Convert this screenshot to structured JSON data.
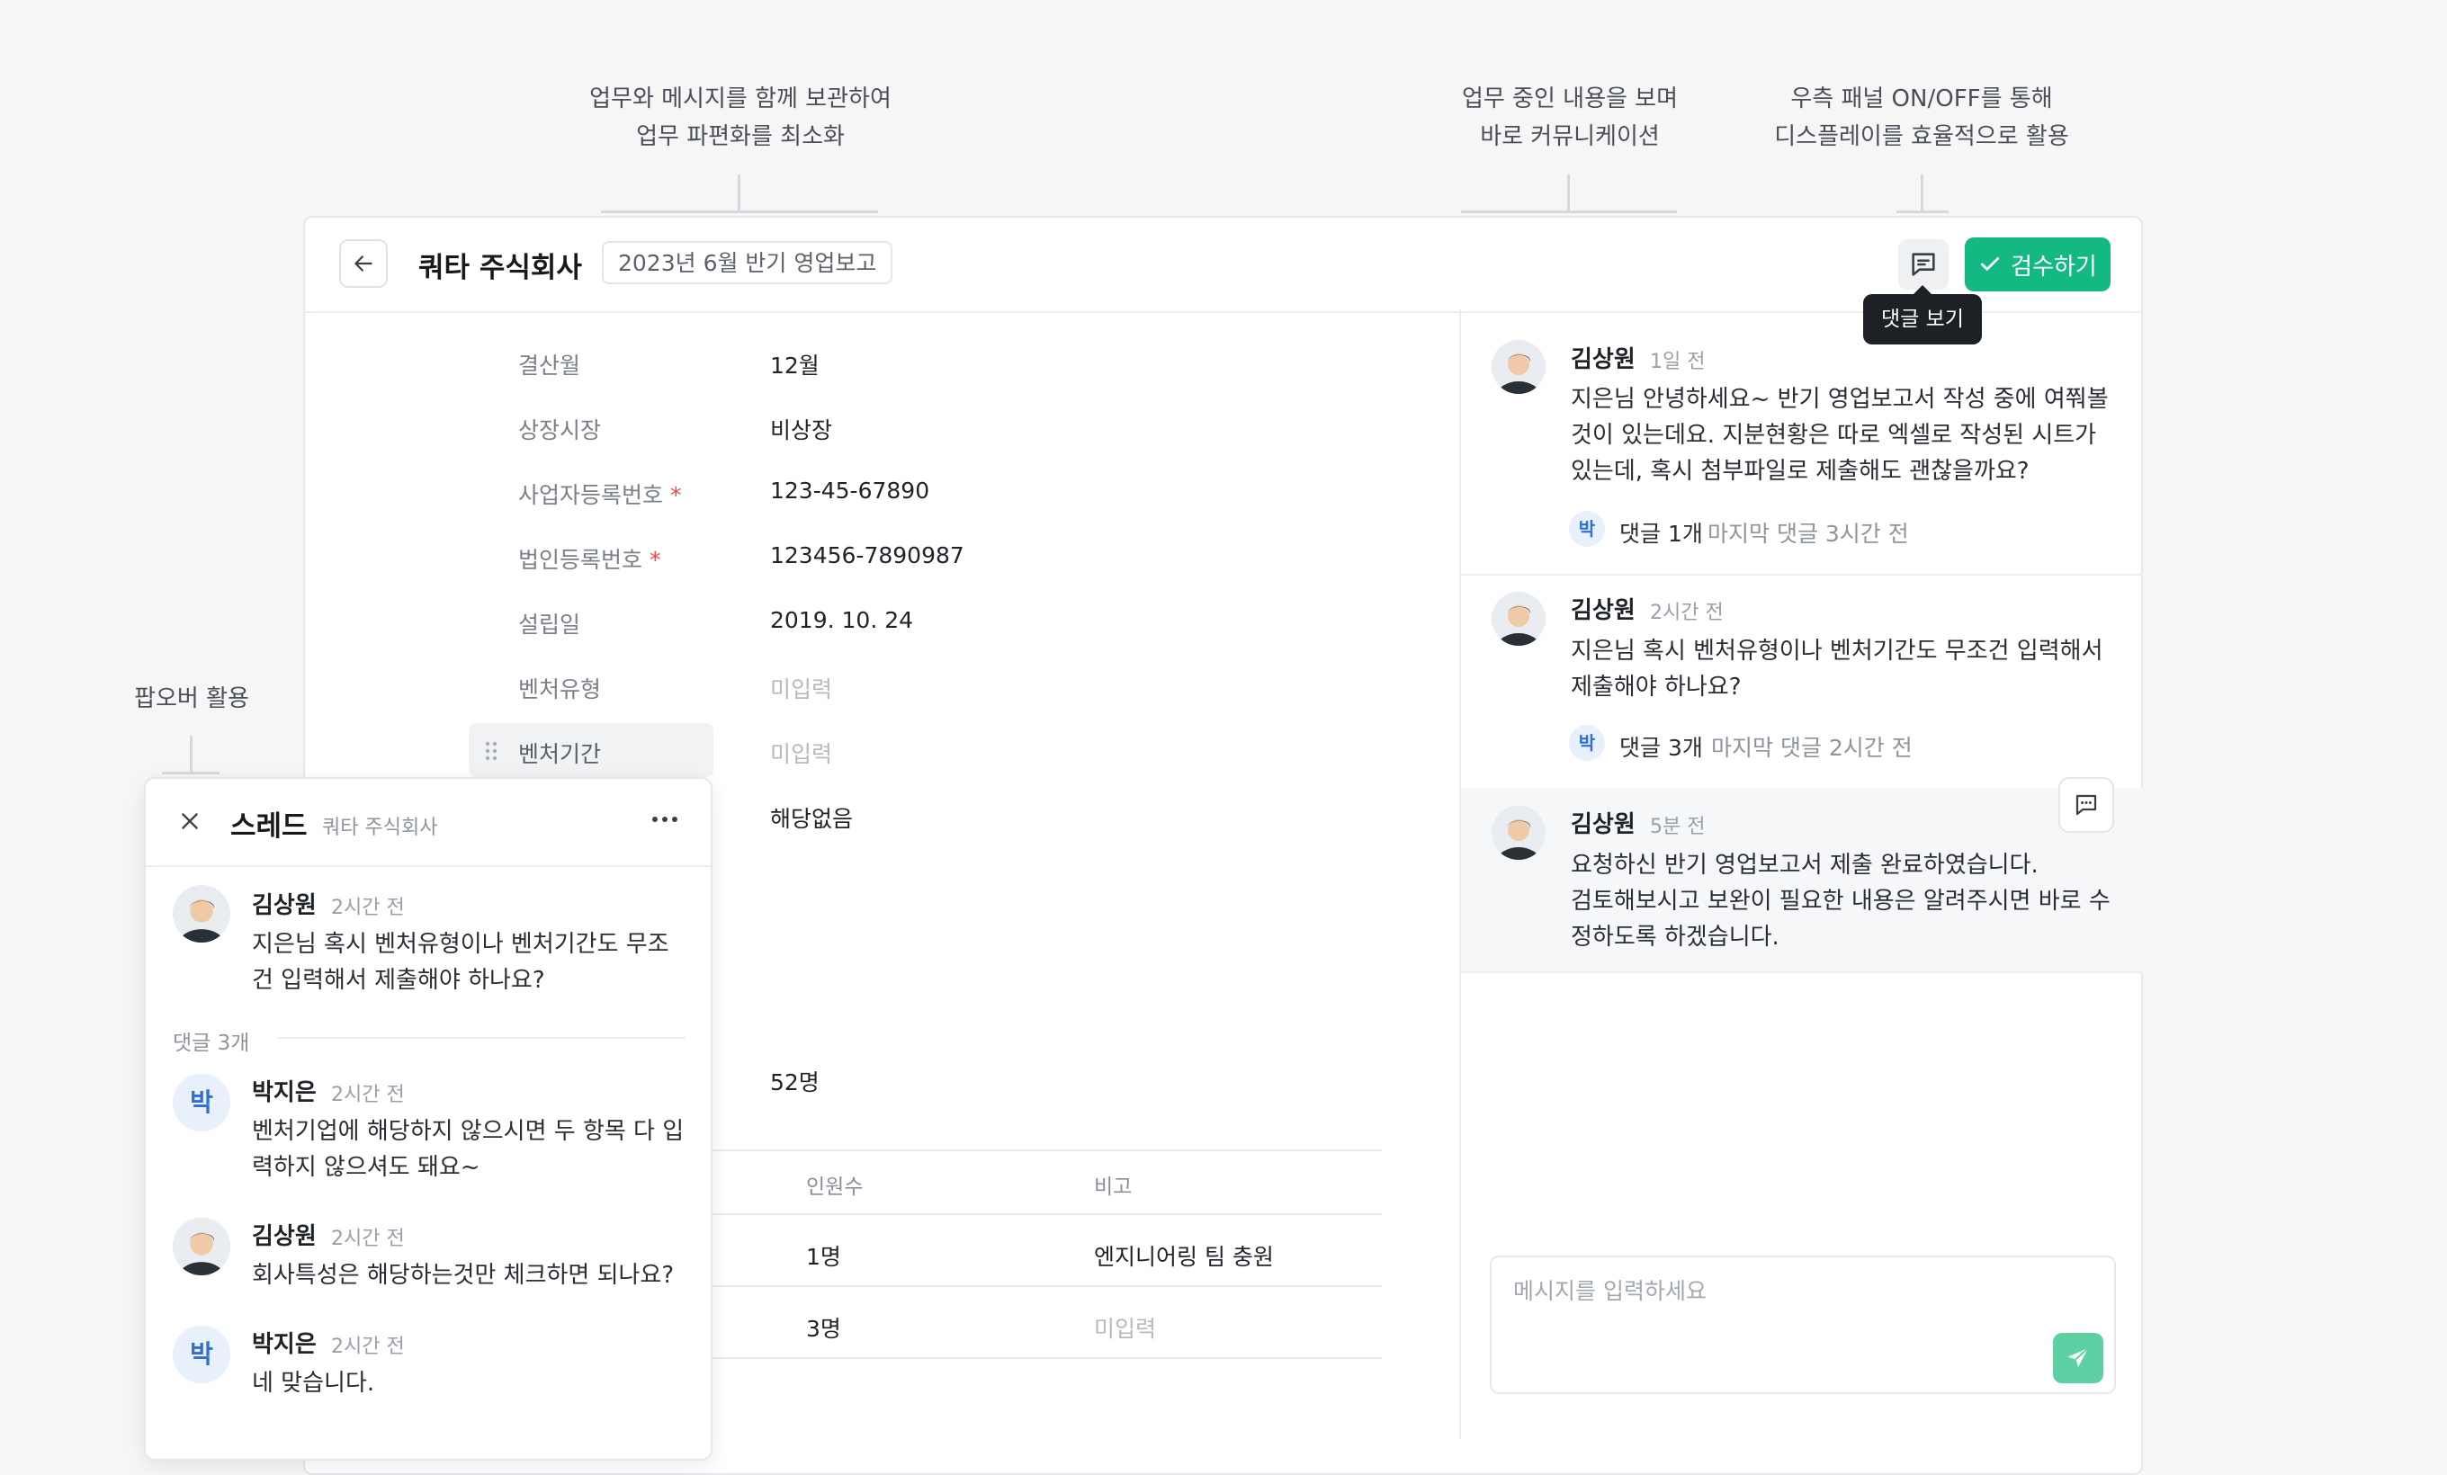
{
  "annotations": {
    "a1": [
      "업무와 메시지를 함께 보관하여",
      "업무 파편화를 최소화"
    ],
    "a2": [
      "업무 중인 내용을 보며",
      "바로 커뮤니케이션"
    ],
    "a3": [
      "우측 패널 ON/OFF를 통해",
      "디스플레이를 효율적으로 활용"
    ],
    "a4": "팝오버 활용"
  },
  "header": {
    "company": "쿼타 주식회사",
    "doc_title": "2023년 6월 반기 영업보고",
    "approve_label": "검수하기",
    "tooltip": "댓글 보기"
  },
  "form": {
    "fields": [
      {
        "label": "결산월",
        "value": "12월",
        "required": false
      },
      {
        "label": "상장시장",
        "value": "비상장",
        "required": false
      },
      {
        "label": "사업자등록번호",
        "value": "123-45-67890",
        "required": true
      },
      {
        "label": "법인등록번호",
        "value": "123456-7890987",
        "required": true
      },
      {
        "label": "설립일",
        "value": "2019. 10. 24",
        "required": false
      },
      {
        "label": "벤처유형",
        "value": "미입력",
        "required": false
      },
      {
        "label": "벤처기간",
        "value": "미입력",
        "required": false
      }
    ],
    "extra_values": [
      "해당없음",
      "52명"
    ],
    "required_mark": "*"
  },
  "table": {
    "headers": [
      "인원수",
      "비고"
    ],
    "rows": [
      {
        "count": "1명",
        "note": "엔지니어링 팀 충원"
      },
      {
        "count": "3명",
        "note": "미입력"
      }
    ]
  },
  "comments": [
    {
      "author": "김상원",
      "time": "1일 전",
      "body": [
        "지은님 안녕하세요~ 반기 영업보고서 작성 중에 여쭤볼",
        "것이 있는데요. 지분현황은 따로 엑셀로 작성된 시트가",
        "있는데, 혹시 첨부파일로 제출해도 괜찮을까요?"
      ],
      "reply_avatar": "박",
      "reply_count": "댓글 1개",
      "reply_last": "마지막 댓글 3시간 전"
    },
    {
      "author": "김상원",
      "time": "2시간 전",
      "body": [
        "지은님 혹시 벤처유형이나 벤처기간도 무조건 입력해서",
        "제출해야 하나요?"
      ],
      "reply_avatar": "박",
      "reply_count": "댓글 3개",
      "reply_last": "마지막 댓글 2시간 전"
    },
    {
      "author": "김상원",
      "time": "5분 전",
      "body": [
        "요청하신 반기 영업보고서 제출 완료하였습니다.",
        "검토해보시고 보완이 필요한 내용은 알려주시면 바로 수",
        "정하도록 하겠습니다."
      ]
    }
  ],
  "message_input": {
    "placeholder": "메시지를 입력하세요"
  },
  "thread": {
    "title": "스레드",
    "subtitle": "쿼타 주식회사",
    "root": {
      "author": "김상원",
      "time": "2시간 전",
      "body": [
        "지은님 혹시 벤처유형이나 벤처기간도 무조",
        "건 입력해서 제출해야 하나요?"
      ]
    },
    "replies_label": "댓글 3개",
    "replies": [
      {
        "author": "박지은",
        "avatar": "박",
        "time": "2시간 전",
        "body": [
          "벤처기업에 해당하지 않으시면 두 항목 다 입",
          "력하지 않으셔도 돼요~"
        ]
      },
      {
        "author": "김상원",
        "time": "2시간 전",
        "body": [
          "회사특성은 해당하는것만 체크하면 되나요?"
        ]
      },
      {
        "author": "박지은",
        "avatar": "박",
        "time": "2시간 전",
        "body": [
          "네 맞습니다."
        ]
      }
    ]
  },
  "colors": {
    "accent": "#13b883",
    "send": "#5fd0a4",
    "required": "#e5484d",
    "mini_avatar_bg": "#e7f0fb",
    "mini_avatar_fg": "#2f6fd1"
  }
}
